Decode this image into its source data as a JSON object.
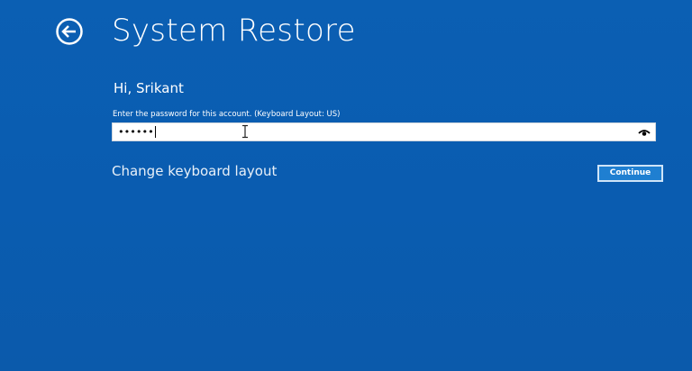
{
  "header": {
    "title": "System Restore",
    "back_icon": "back-arrow-icon"
  },
  "account": {
    "greeting": "Hi, Srikant",
    "password_label": "Enter the password for this account. (Keyboard Layout: US)",
    "password_value": "••••••",
    "reveal_icon": "eye-reveal-icon"
  },
  "links": {
    "change_keyboard_layout": "Change keyboard layout"
  },
  "actions": {
    "continue_label": "Continue"
  },
  "colors": {
    "background": "#0a5db1",
    "button_fill": "#1f7fd1",
    "button_border": "#cfe4f7"
  }
}
